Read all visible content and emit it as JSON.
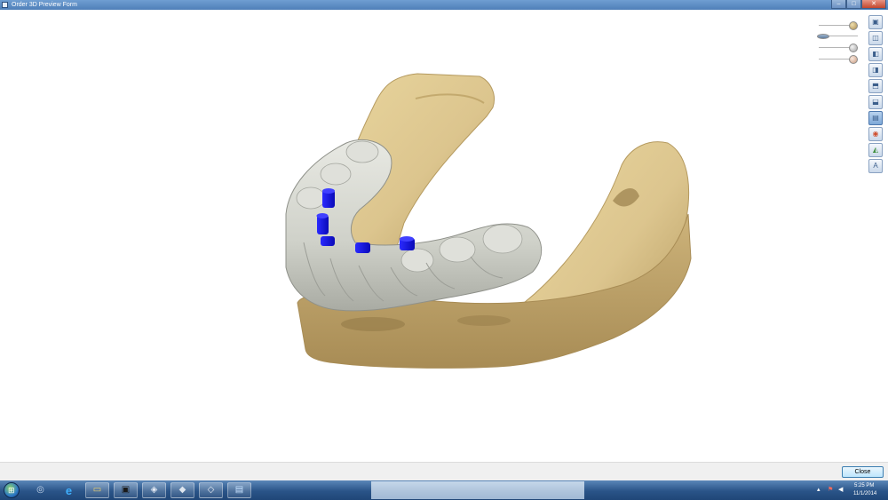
{
  "window": {
    "title": "Order 3D Preview Form",
    "controls": [
      "–",
      "□",
      "✕"
    ]
  },
  "colors": {
    "stone_model": "#dcc58e",
    "gypsum_shadow": "#b59a5f",
    "tooth_guide": "#d2d4cc",
    "implant_markers": "#1010e0",
    "titlebar": "#5b8cc6",
    "taskbar": "#2a5488"
  },
  "view_controls": {
    "sliders": [
      {
        "icon": "model-opacity-icon",
        "level": 0.85
      },
      {
        "icon": "transparency-icon",
        "level": 0.1
      },
      {
        "icon": "gingiva-opacity-icon",
        "level": 0.85
      },
      {
        "icon": "tooth-opacity-icon",
        "level": 0.85
      }
    ],
    "tools": [
      {
        "icon": "view-front-icon",
        "glyph": "▣"
      },
      {
        "icon": "view-back-icon",
        "glyph": "◫"
      },
      {
        "icon": "view-left-icon",
        "glyph": "◧"
      },
      {
        "icon": "view-right-icon",
        "glyph": "◨"
      },
      {
        "icon": "view-top-icon",
        "glyph": "⬒"
      },
      {
        "icon": "view-bottom-icon",
        "glyph": "⬓"
      },
      {
        "icon": "occlusion-view-icon",
        "glyph": "▤",
        "active": true
      },
      {
        "icon": "color-map-icon",
        "glyph": "◉"
      },
      {
        "icon": "distance-map-icon",
        "glyph": "◭"
      },
      {
        "icon": "annotation-icon",
        "glyph": "A"
      }
    ]
  },
  "footer": {
    "close_label": "Close"
  },
  "taskbar": {
    "start_glyph": "⊞",
    "pinned": [
      {
        "icon": "network-icon",
        "glyph": "◎"
      },
      {
        "icon": "internet-explorer-icon",
        "glyph": "e"
      },
      {
        "icon": "file-explorer-icon",
        "glyph": "▭"
      },
      {
        "icon": "dental-app-icon",
        "glyph": "▣"
      },
      {
        "icon": "scan-viewer-icon",
        "glyph": "◈"
      },
      {
        "icon": "cad-app-icon",
        "glyph": "◆"
      },
      {
        "icon": "design-tool-icon",
        "glyph": "◇"
      },
      {
        "icon": "remote-desktop-icon",
        "glyph": "▤"
      }
    ],
    "tray_glyphs": [
      "▴",
      "⚑",
      "◀"
    ],
    "clock_time": "5:25 PM",
    "clock_date": "11/1/2014"
  }
}
